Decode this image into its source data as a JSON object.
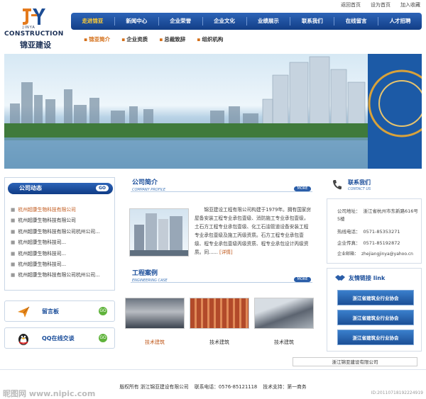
{
  "logo": {
    "sub": "JINYA",
    "en": "CONSTRUCTION",
    "cn": "锦亚建设"
  },
  "toplinks": [
    "返回首页",
    "设为首页",
    "加入收藏"
  ],
  "nav": [
    "走进锦亚",
    "新闻中心",
    "企业荣誉",
    "企业文化",
    "业绩展示",
    "联系我们",
    "在线留言",
    "人才招聘"
  ],
  "subnav": [
    "锦亚简介",
    "企业资质",
    "总裁致辞",
    "组织机构"
  ],
  "news": {
    "title": "公司动态",
    "more": "GO",
    "items": [
      "杭州超康生物科技有限公司",
      "杭州超康生物科技有限公司",
      "杭州超康生物科技有限公司杭州公司...",
      "杭州超康生物科技司...",
      "杭州超康生物科技司...",
      "杭州超康生物科技司...",
      "杭州超康生物科技有限公司杭州公司..."
    ]
  },
  "side": [
    {
      "label": "留言板",
      "go": "GO"
    },
    {
      "label": "QQ在线交谈",
      "go": "GO"
    }
  ],
  "profile": {
    "title": "公司简介",
    "sub": "COMPANY PROFILE",
    "more": "MORE",
    "text": "锦亚建设工程有限公司构建于1979年。拥有国家房屋备安装工程专业承包壹级、消防施工专业承包壹级，土石方工程专业承包壹级、化工石油管道设备安装工程专业承包壹级及施工丙级资质。石方工程专业承包壹级、程专业承包壹级丙级资质、程专业承包设计丙级资质。同......",
    "detail": "[详情]"
  },
  "cases": {
    "title": "工程案例",
    "sub": "ENGINEERING CASE",
    "more": "MORE",
    "items": [
      "技术建筑",
      "技术建筑",
      "技术建筑"
    ]
  },
  "contact": {
    "title": "联系我们",
    "sub": "CONTACT US",
    "rows": [
      {
        "k": "公司地址：",
        "v": "浙江省杭州市东新路616号5楼"
      },
      {
        "k": "热线电话：",
        "v": "0571-85353271"
      },
      {
        "k": "企业传真：",
        "v": "0571-85192872"
      },
      {
        "k": "企业邮箱：",
        "v": "zhejiangjinya@yahoo.cn"
      }
    ]
  },
  "links": {
    "title": "友情链接 link",
    "items": [
      "浙江省建筑业行业协会",
      "浙江省建筑业行业协会",
      "浙江省建筑业行业协会"
    ]
  },
  "footer": {
    "company_box": "浙江锦亚建设有限公司",
    "copyright": "版权所有 浙江锦亚建设有限公司",
    "phone": "联系电话：0576-85121118",
    "support": "技术支持：第一商务",
    "watermark_left": "昵图网 www.nipic.com",
    "watermark_right": "ID:20110718192224919"
  }
}
